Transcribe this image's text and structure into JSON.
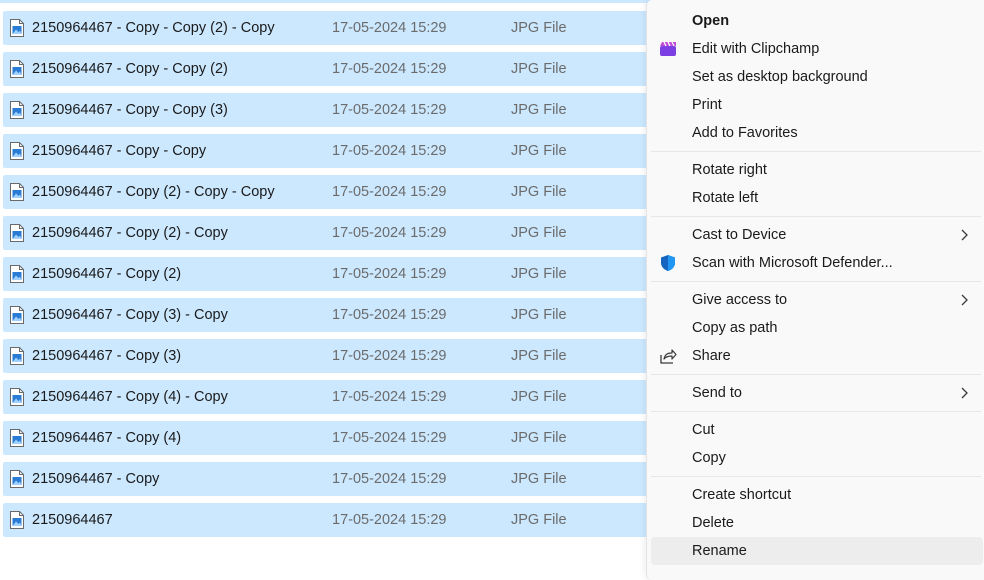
{
  "files": [
    {
      "name": "2150964467 - Copy - Copy (2) - Copy",
      "date": "17-05-2024 15:29",
      "type": "JPG File"
    },
    {
      "name": "2150964467 - Copy - Copy (2)",
      "date": "17-05-2024 15:29",
      "type": "JPG File"
    },
    {
      "name": "2150964467 - Copy - Copy (3)",
      "date": "17-05-2024 15:29",
      "type": "JPG File"
    },
    {
      "name": "2150964467 - Copy - Copy",
      "date": "17-05-2024 15:29",
      "type": "JPG File"
    },
    {
      "name": "2150964467 - Copy (2) - Copy - Copy",
      "date": "17-05-2024 15:29",
      "type": "JPG File"
    },
    {
      "name": "2150964467 - Copy (2) - Copy",
      "date": "17-05-2024 15:29",
      "type": "JPG File"
    },
    {
      "name": "2150964467 - Copy (2)",
      "date": "17-05-2024 15:29",
      "type": "JPG File"
    },
    {
      "name": "2150964467 - Copy (3) - Copy",
      "date": "17-05-2024 15:29",
      "type": "JPG File"
    },
    {
      "name": "2150964467 - Copy (3)",
      "date": "17-05-2024 15:29",
      "type": "JPG File"
    },
    {
      "name": "2150964467 - Copy (4) - Copy",
      "date": "17-05-2024 15:29",
      "type": "JPG File"
    },
    {
      "name": "2150964467 - Copy (4)",
      "date": "17-05-2024 15:29",
      "type": "JPG File"
    },
    {
      "name": "2150964467 - Copy",
      "date": "17-05-2024 15:29",
      "type": "JPG File"
    },
    {
      "name": "2150964467",
      "date": "17-05-2024 15:29",
      "type": "JPG File"
    }
  ],
  "menu": {
    "open": "Open",
    "edit_clipchamp": "Edit with Clipchamp",
    "set_background": "Set as desktop background",
    "print": "Print",
    "add_favorites": "Add to Favorites",
    "rotate_right": "Rotate right",
    "rotate_left": "Rotate left",
    "cast": "Cast to Device",
    "scan": "Scan with Microsoft Defender...",
    "give_access": "Give access to",
    "copy_path": "Copy as path",
    "share": "Share",
    "send_to": "Send to",
    "cut": "Cut",
    "copy": "Copy",
    "create_shortcut": "Create shortcut",
    "delete": "Delete",
    "rename": "Rename"
  },
  "icons": {
    "file": "jpg-file-icon",
    "clipchamp": "clipchamp-icon",
    "defender": "defender-shield-icon",
    "share": "share-icon",
    "submenu": "chevron-right-icon"
  },
  "colors": {
    "selection": "#cce8ff",
    "menu_bg": "#f9f9f9",
    "hover": "#ededed",
    "clipchamp": "#7b3fe4",
    "defender": "#1565c0"
  }
}
